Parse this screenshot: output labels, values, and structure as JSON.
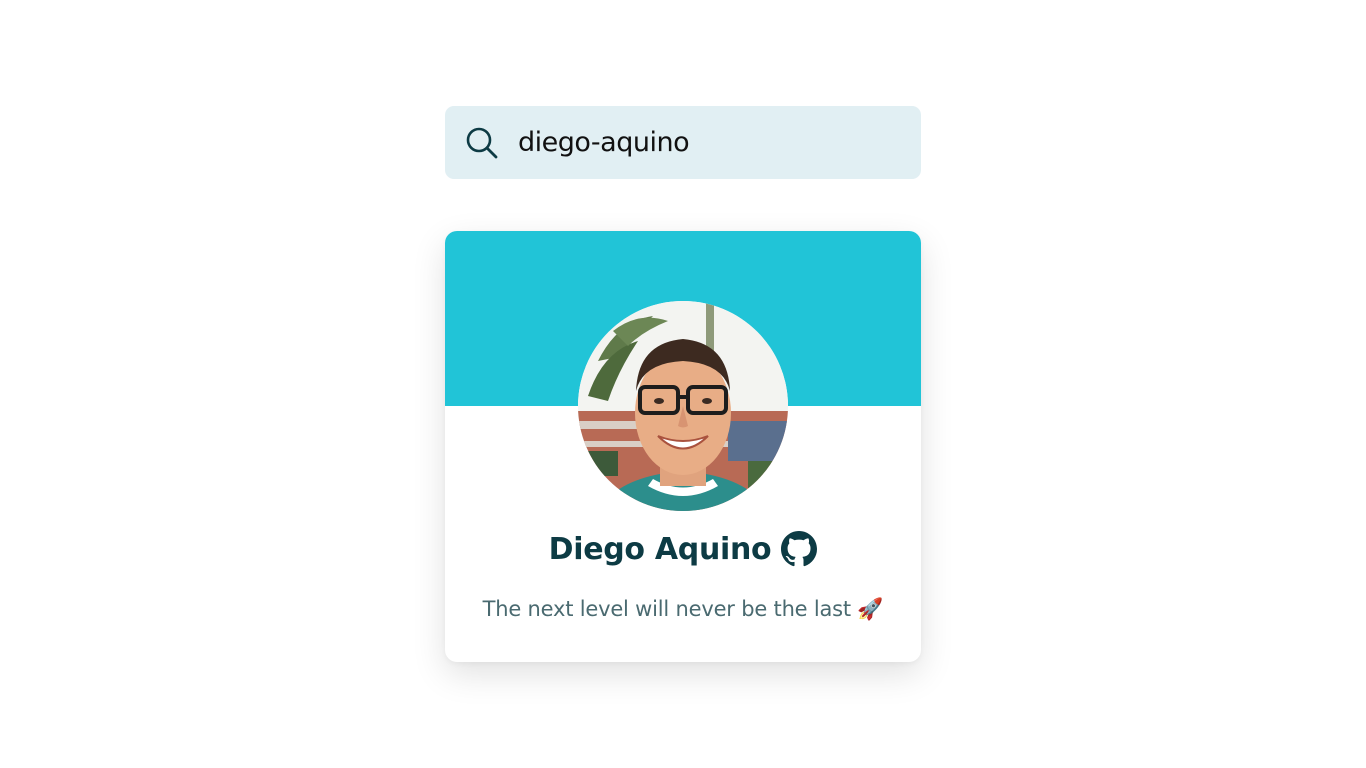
{
  "search": {
    "value": "diego-aquino",
    "icon": "search-icon"
  },
  "profile": {
    "name": "Diego Aquino",
    "bio": "The next level will never be the last 🚀",
    "github_icon": "github-icon",
    "avatar_alt": "Diego Aquino"
  },
  "colors": {
    "accent": "#21c4d7",
    "search_bg": "#e1eff3",
    "name": "#0d3b44",
    "bio": "#4a6a70"
  }
}
